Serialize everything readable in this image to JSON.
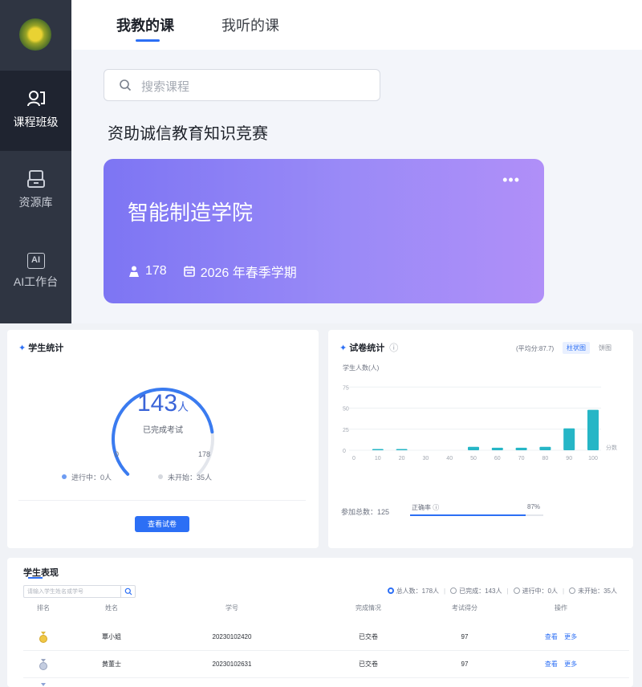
{
  "sidebar": {
    "items": [
      {
        "label": "课程班级",
        "icon": "class-icon",
        "active": true
      },
      {
        "label": "资源库",
        "icon": "resource-library-icon",
        "active": false
      },
      {
        "label": "AI工作台",
        "icon": "ai-icon",
        "active": false,
        "badge": "AI"
      }
    ]
  },
  "tabs": [
    {
      "label": "我教的课",
      "active": true
    },
    {
      "label": "我听的课",
      "active": false
    }
  ],
  "search": {
    "placeholder": "搜索课程"
  },
  "section_title": "资助诚信教育知识竞赛",
  "course_card": {
    "name": "智能制造学院",
    "more": "•••",
    "students": "178",
    "term": "2026 年春季学期"
  },
  "student_stats": {
    "title": "学生统计",
    "count": "143",
    "unit": "人",
    "subtitle": "已完成考试",
    "min": "0",
    "max": "178",
    "in_progress": "进行中：0人",
    "not_started": "未开始：35人",
    "button": "查看试卷",
    "progress_fraction": 0.803
  },
  "exam_stats": {
    "title": "试卷统计",
    "avg": "(平均分:87.7)",
    "toggle_on": "柱状图",
    "toggle_off": "饼图",
    "ylabel": "学生人数(人)",
    "xlabel": "分数",
    "total_label": "参加总数：125",
    "pass_label": "正确率",
    "pass_value": "87%",
    "pass_fraction": 0.87
  },
  "chart_data": {
    "type": "bar",
    "ylabel": "学生人数(人)",
    "xlabel": "分数",
    "categories": [
      "0",
      "10",
      "20",
      "30",
      "40",
      "50",
      "60",
      "70",
      "80",
      "90",
      "100"
    ],
    "y_ticks": [
      "0",
      "25",
      "50",
      "75"
    ],
    "ylim": [
      0,
      80
    ],
    "values": [
      0,
      1,
      1,
      0,
      0,
      4,
      3,
      3,
      4,
      26,
      48
    ],
    "color": "#26b6c6"
  },
  "table": {
    "title": "学生表现",
    "search_placeholder": "请输入学生姓名或学号",
    "filters": [
      {
        "label": "总人数：178人",
        "checked": true
      },
      {
        "label": "已完成：143人",
        "checked": false
      },
      {
        "label": "进行中：0人",
        "checked": false
      },
      {
        "label": "未开始：35人",
        "checked": false
      }
    ],
    "columns": [
      "排名",
      "姓名",
      "学号",
      "完成情况",
      "考试得分",
      "操作"
    ],
    "rows": [
      {
        "rank_icon": "gold-medal-icon",
        "name": "覃小姐",
        "id": "20230102420",
        "status": "已交卷",
        "score": "97",
        "view": "查看",
        "more": "更多"
      },
      {
        "rank_icon": "silver-medal-icon",
        "name": "黄董士",
        "id": "20230102631",
        "status": "已交卷",
        "score": "97",
        "view": "查看",
        "more": "更多"
      }
    ]
  }
}
